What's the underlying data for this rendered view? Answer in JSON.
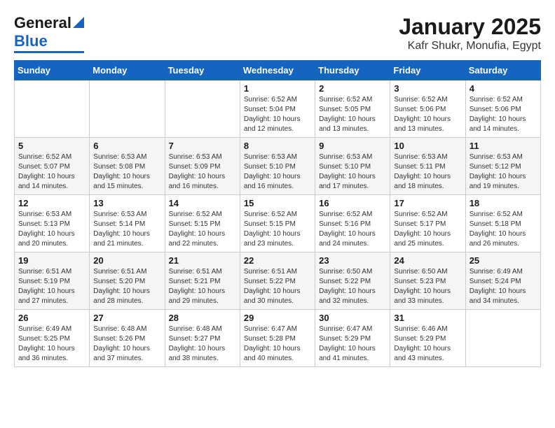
{
  "header": {
    "logo_line1": "General",
    "logo_line2": "Blue",
    "title": "January 2025",
    "subtitle": "Kafr Shukr, Monufia, Egypt"
  },
  "calendar": {
    "days_of_week": [
      "Sunday",
      "Monday",
      "Tuesday",
      "Wednesday",
      "Thursday",
      "Friday",
      "Saturday"
    ],
    "weeks": [
      [
        {
          "day": "",
          "info": ""
        },
        {
          "day": "",
          "info": ""
        },
        {
          "day": "",
          "info": ""
        },
        {
          "day": "1",
          "info": "Sunrise: 6:52 AM\nSunset: 5:04 PM\nDaylight: 10 hours\nand 12 minutes."
        },
        {
          "day": "2",
          "info": "Sunrise: 6:52 AM\nSunset: 5:05 PM\nDaylight: 10 hours\nand 13 minutes."
        },
        {
          "day": "3",
          "info": "Sunrise: 6:52 AM\nSunset: 5:06 PM\nDaylight: 10 hours\nand 13 minutes."
        },
        {
          "day": "4",
          "info": "Sunrise: 6:52 AM\nSunset: 5:06 PM\nDaylight: 10 hours\nand 14 minutes."
        }
      ],
      [
        {
          "day": "5",
          "info": "Sunrise: 6:52 AM\nSunset: 5:07 PM\nDaylight: 10 hours\nand 14 minutes."
        },
        {
          "day": "6",
          "info": "Sunrise: 6:53 AM\nSunset: 5:08 PM\nDaylight: 10 hours\nand 15 minutes."
        },
        {
          "day": "7",
          "info": "Sunrise: 6:53 AM\nSunset: 5:09 PM\nDaylight: 10 hours\nand 16 minutes."
        },
        {
          "day": "8",
          "info": "Sunrise: 6:53 AM\nSunset: 5:10 PM\nDaylight: 10 hours\nand 16 minutes."
        },
        {
          "day": "9",
          "info": "Sunrise: 6:53 AM\nSunset: 5:10 PM\nDaylight: 10 hours\nand 17 minutes."
        },
        {
          "day": "10",
          "info": "Sunrise: 6:53 AM\nSunset: 5:11 PM\nDaylight: 10 hours\nand 18 minutes."
        },
        {
          "day": "11",
          "info": "Sunrise: 6:53 AM\nSunset: 5:12 PM\nDaylight: 10 hours\nand 19 minutes."
        }
      ],
      [
        {
          "day": "12",
          "info": "Sunrise: 6:53 AM\nSunset: 5:13 PM\nDaylight: 10 hours\nand 20 minutes."
        },
        {
          "day": "13",
          "info": "Sunrise: 6:53 AM\nSunset: 5:14 PM\nDaylight: 10 hours\nand 21 minutes."
        },
        {
          "day": "14",
          "info": "Sunrise: 6:52 AM\nSunset: 5:15 PM\nDaylight: 10 hours\nand 22 minutes."
        },
        {
          "day": "15",
          "info": "Sunrise: 6:52 AM\nSunset: 5:15 PM\nDaylight: 10 hours\nand 23 minutes."
        },
        {
          "day": "16",
          "info": "Sunrise: 6:52 AM\nSunset: 5:16 PM\nDaylight: 10 hours\nand 24 minutes."
        },
        {
          "day": "17",
          "info": "Sunrise: 6:52 AM\nSunset: 5:17 PM\nDaylight: 10 hours\nand 25 minutes."
        },
        {
          "day": "18",
          "info": "Sunrise: 6:52 AM\nSunset: 5:18 PM\nDaylight: 10 hours\nand 26 minutes."
        }
      ],
      [
        {
          "day": "19",
          "info": "Sunrise: 6:51 AM\nSunset: 5:19 PM\nDaylight: 10 hours\nand 27 minutes."
        },
        {
          "day": "20",
          "info": "Sunrise: 6:51 AM\nSunset: 5:20 PM\nDaylight: 10 hours\nand 28 minutes."
        },
        {
          "day": "21",
          "info": "Sunrise: 6:51 AM\nSunset: 5:21 PM\nDaylight: 10 hours\nand 29 minutes."
        },
        {
          "day": "22",
          "info": "Sunrise: 6:51 AM\nSunset: 5:22 PM\nDaylight: 10 hours\nand 30 minutes."
        },
        {
          "day": "23",
          "info": "Sunrise: 6:50 AM\nSunset: 5:22 PM\nDaylight: 10 hours\nand 32 minutes."
        },
        {
          "day": "24",
          "info": "Sunrise: 6:50 AM\nSunset: 5:23 PM\nDaylight: 10 hours\nand 33 minutes."
        },
        {
          "day": "25",
          "info": "Sunrise: 6:49 AM\nSunset: 5:24 PM\nDaylight: 10 hours\nand 34 minutes."
        }
      ],
      [
        {
          "day": "26",
          "info": "Sunrise: 6:49 AM\nSunset: 5:25 PM\nDaylight: 10 hours\nand 36 minutes."
        },
        {
          "day": "27",
          "info": "Sunrise: 6:48 AM\nSunset: 5:26 PM\nDaylight: 10 hours\nand 37 minutes."
        },
        {
          "day": "28",
          "info": "Sunrise: 6:48 AM\nSunset: 5:27 PM\nDaylight: 10 hours\nand 38 minutes."
        },
        {
          "day": "29",
          "info": "Sunrise: 6:47 AM\nSunset: 5:28 PM\nDaylight: 10 hours\nand 40 minutes."
        },
        {
          "day": "30",
          "info": "Sunrise: 6:47 AM\nSunset: 5:29 PM\nDaylight: 10 hours\nand 41 minutes."
        },
        {
          "day": "31",
          "info": "Sunrise: 6:46 AM\nSunset: 5:29 PM\nDaylight: 10 hours\nand 43 minutes."
        },
        {
          "day": "",
          "info": ""
        }
      ]
    ]
  }
}
